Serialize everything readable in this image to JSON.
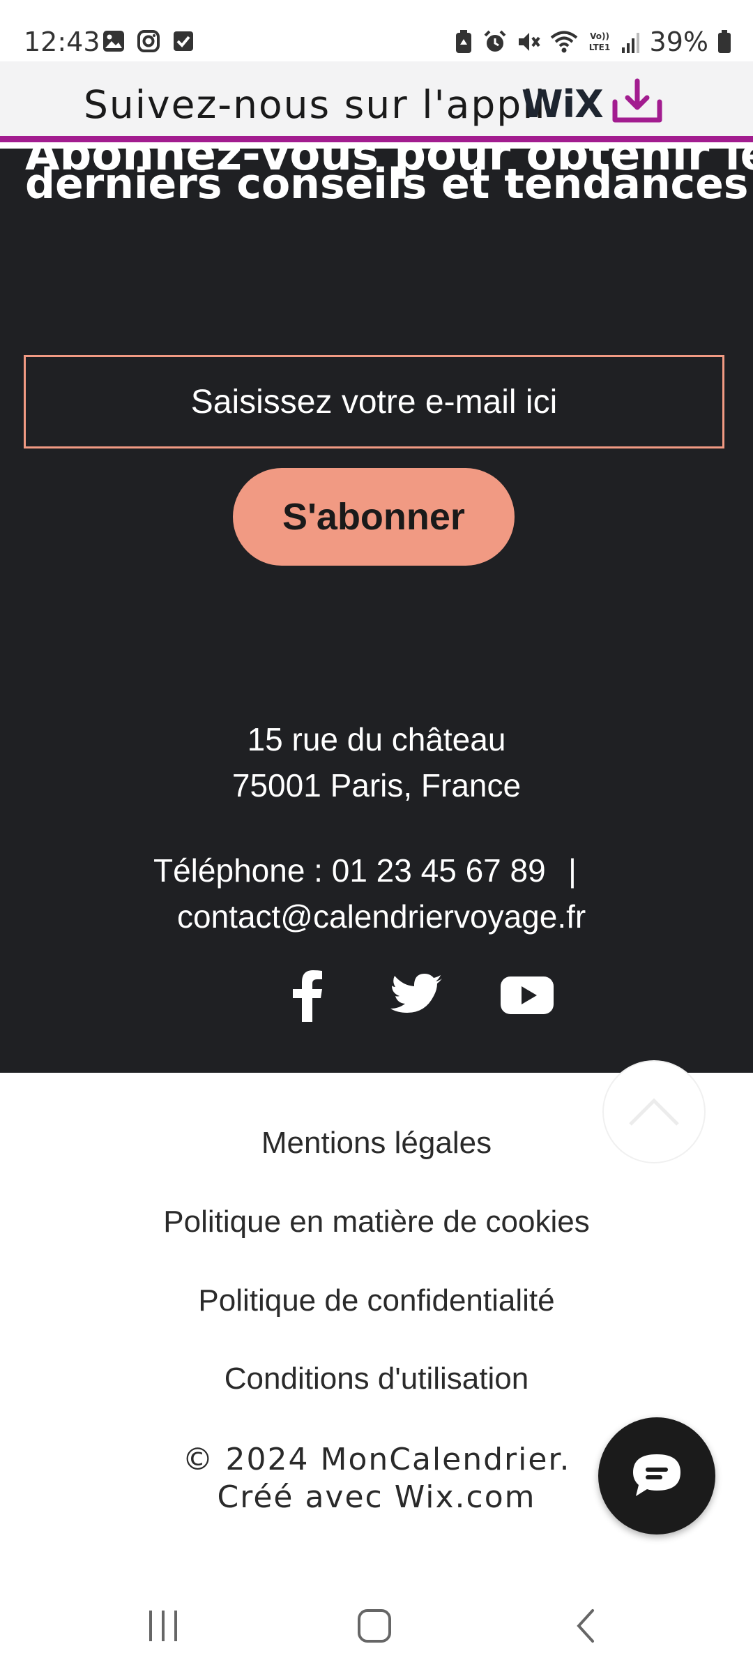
{
  "status_bar": {
    "time": "12:43",
    "battery": "39%",
    "left_icons": [
      "gallery-icon",
      "instagram-icon",
      "checkbox-icon"
    ],
    "right_icons": [
      "battery-saver-icon",
      "alarm-icon",
      "mute-icon",
      "wifi-icon",
      "volte-icon",
      "signal-icon",
      "battery-icon"
    ],
    "volte_label": "Vo))\nLTE1"
  },
  "banner": {
    "text": "Suivez-nous sur l'appli",
    "brand": "WiX",
    "download_icon": "download-icon",
    "accent_color": "#a21c8f"
  },
  "subscribe": {
    "heading_line1": "Abonnez-vous pour obtenir les",
    "heading_line2": "derniers conseils et tendances",
    "email_placeholder": "Saisissez votre e-mail ici",
    "button_label": "S'abonner",
    "accent_color": "#f19a83",
    "background": "#1f2023"
  },
  "contact": {
    "address_line1": "15 rue du château",
    "address_line2": "75001 Paris, France",
    "phone": "Téléphone : 01 23 45 67 89",
    "separator": "|",
    "email": "contact@calendriervoyage.fr"
  },
  "social": [
    "facebook-icon",
    "twitter-icon",
    "youtube-icon"
  ],
  "footer": {
    "links": [
      "Mentions légales",
      "Politique en matière de cookies",
      "Politique de confidentialité",
      "Conditions d'utilisation"
    ],
    "copyright_line1": "© 2024 MonCalendrier.",
    "copyright_line2": "Créé avec Wix.com"
  },
  "nav": [
    "recents-icon",
    "home-icon",
    "back-icon"
  ]
}
